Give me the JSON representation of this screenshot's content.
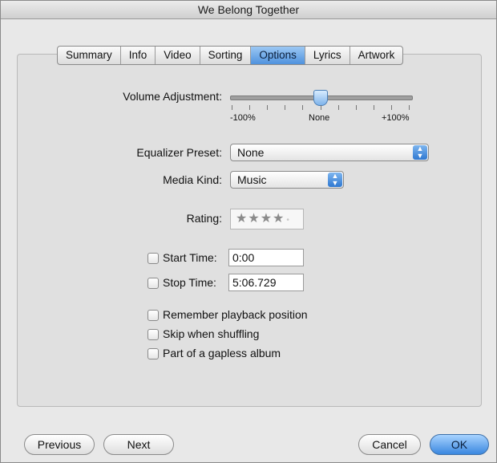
{
  "window": {
    "title": "We Belong Together"
  },
  "tabs": [
    {
      "label": "Summary",
      "active": false
    },
    {
      "label": "Info",
      "active": false
    },
    {
      "label": "Video",
      "active": false
    },
    {
      "label": "Sorting",
      "active": false
    },
    {
      "label": "Options",
      "active": true
    },
    {
      "label": "Lyrics",
      "active": false
    },
    {
      "label": "Artwork",
      "active": false
    }
  ],
  "volume": {
    "label": "Volume Adjustment:",
    "value_percent": 0,
    "min_label": "-100%",
    "mid_label": "None",
    "max_label": "+100%"
  },
  "equalizer": {
    "label": "Equalizer Preset:",
    "value": "None"
  },
  "media_kind": {
    "label": "Media Kind:",
    "value": "Music"
  },
  "rating": {
    "label": "Rating:",
    "stars": 4,
    "max": 5,
    "display": "★★★★"
  },
  "start_time": {
    "label": "Start Time:",
    "value": "0:00",
    "checked": false
  },
  "stop_time": {
    "label": "Stop Time:",
    "value": "5:06.729",
    "checked": false
  },
  "options": [
    {
      "label": "Remember playback position",
      "checked": false
    },
    {
      "label": "Skip when shuffling",
      "checked": false
    },
    {
      "label": "Part of a gapless album",
      "checked": false
    }
  ],
  "buttons": {
    "previous": "Previous",
    "next": "Next",
    "cancel": "Cancel",
    "ok": "OK"
  },
  "colors": {
    "accent": "#4f92de",
    "window_bg": "#e8e8e8"
  }
}
